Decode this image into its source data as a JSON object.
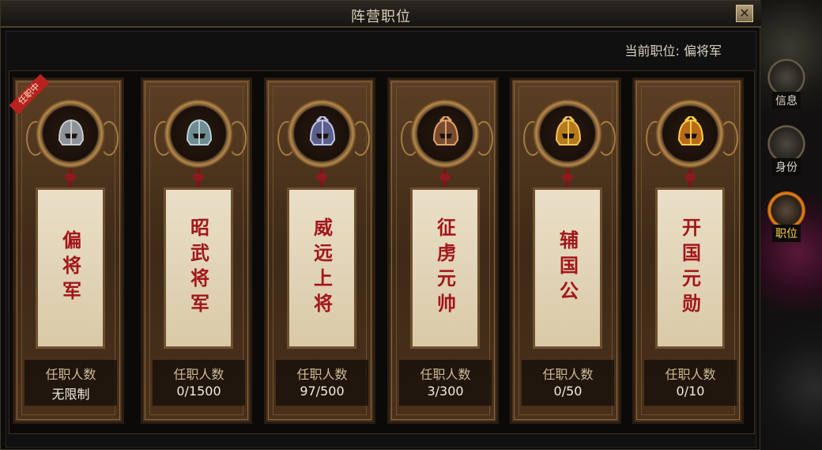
{
  "window": {
    "title": "阵营职位",
    "close_glyph": "✕"
  },
  "current_position": {
    "label": "当前职位:",
    "value": "偏将军"
  },
  "ranks": [
    {
      "name": "偏将军",
      "count_label": "任职人数",
      "count": "无限制",
      "badge": "任职中",
      "helmet_color": "#8e9296",
      "helmet_trim": "#c9cdd1",
      "icon": "iron-helmet-icon"
    },
    {
      "name": "昭武将军",
      "count_label": "任职人数",
      "count": "0/1500",
      "helmet_color": "#6f8c93",
      "helmet_trim": "#b7d1d6",
      "icon": "steel-helmet-icon"
    },
    {
      "name": "威远上将",
      "count_label": "任职人数",
      "count": "97/500",
      "helmet_color": "#5a5f8c",
      "helmet_trim": "#c3c6e8",
      "icon": "crested-helmet-icon"
    },
    {
      "name": "征虏元帅",
      "count_label": "任职人数",
      "count": "3/300",
      "helmet_color": "#7a4a2f",
      "helmet_trim": "#e0a36b",
      "icon": "marshal-helmet-icon"
    },
    {
      "name": "辅国公",
      "count_label": "任职人数",
      "count": "0/50",
      "helmet_color": "#b57a1c",
      "helmet_trim": "#f2c35a",
      "icon": "golden-helmet-icon"
    },
    {
      "name": "开国元勋",
      "count_label": "任职人数",
      "count": "0/10",
      "helmet_color": "#b86a18",
      "helmet_trim": "#ffcf4a",
      "icon": "crowned-golden-helmet-icon"
    }
  ],
  "side_tabs": [
    {
      "label": "信息",
      "icon": "info-scroll-icon",
      "active": false
    },
    {
      "label": "身份",
      "icon": "identity-mask-icon",
      "active": false
    },
    {
      "label": "职位",
      "icon": "position-emblem-icon",
      "active": true
    }
  ],
  "colors": {
    "tag_text": "#a2161b",
    "active_tab": "#ffd24a",
    "badge": "#b8221e"
  }
}
